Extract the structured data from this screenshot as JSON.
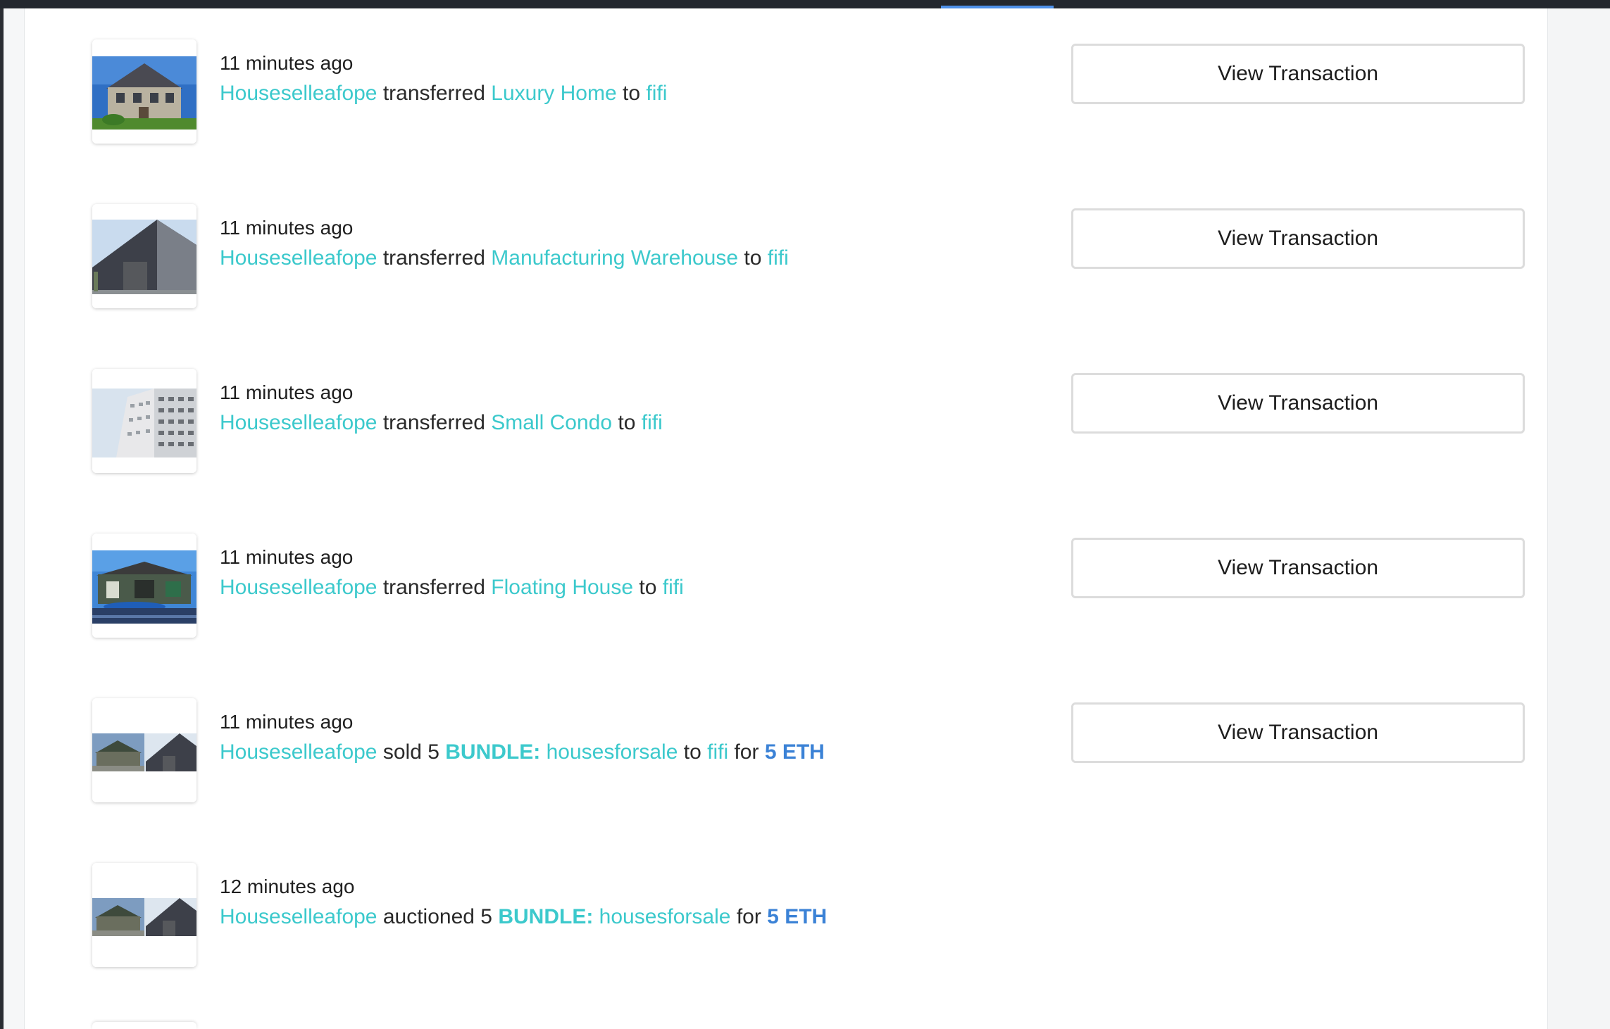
{
  "activity": [
    {
      "time": "11 minutes ago",
      "actor": "Houseselleafope",
      "action": "transferred",
      "item": "Luxury Home",
      "to_word": "to",
      "recipient": "fifi",
      "button": "View Transaction"
    },
    {
      "time": "11 minutes ago",
      "actor": "Houseselleafope",
      "action": "transferred",
      "item": "Manufacturing Warehouse",
      "to_word": "to",
      "recipient": "fifi",
      "button": "View Transaction"
    },
    {
      "time": "11 minutes ago",
      "actor": "Houseselleafope",
      "action": "transferred",
      "item": "Small Condo",
      "to_word": "to",
      "recipient": "fifi",
      "button": "View Transaction"
    },
    {
      "time": "11 minutes ago",
      "actor": "Houseselleafope",
      "action": "transferred",
      "item": "Floating House",
      "to_word": "to",
      "recipient": "fifi",
      "button": "View Transaction"
    },
    {
      "time": "11 minutes ago",
      "actor": "Houseselleafope",
      "action": "sold 5",
      "bundle_prefix": "BUNDLE:",
      "bundle_name": "housesforsale",
      "to_word": "to",
      "recipient": "fifi",
      "for_word": "for",
      "price": "5 ETH",
      "button": "View Transaction"
    },
    {
      "time": "12 minutes ago",
      "actor": "Houseselleafope",
      "action": "auctioned 5",
      "bundle_prefix": "BUNDLE:",
      "bundle_name": "housesforsale",
      "for_word": "for",
      "price": "5 ETH"
    }
  ],
  "colors": {
    "link": "#3cc9cc",
    "price": "#3b82d6",
    "accent": "#4d8fe8"
  }
}
